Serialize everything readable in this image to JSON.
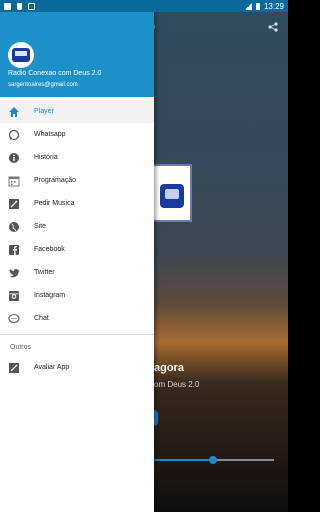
{
  "status_bar": {
    "time": "13:29",
    "icons": [
      "download-icon",
      "music-icon",
      "n-icon"
    ]
  },
  "player": {
    "header_fragment": "0",
    "title_fragment": "agora",
    "subtitle_fragment": "om Deus 2.0",
    "seek_progress": 0.49
  },
  "drawer": {
    "station_name": "Radio Conexao com Deus 2.0",
    "email": "sargentoaires@gmail.com",
    "items": [
      {
        "label": "Player",
        "icon": "home-icon",
        "active": true
      },
      {
        "label": "Whatsapp",
        "icon": "whatsapp-icon",
        "active": false
      },
      {
        "label": "História",
        "icon": "info-icon",
        "active": false
      },
      {
        "label": "Programação",
        "icon": "calendar-icon",
        "active": false
      },
      {
        "label": "Pedir Musica",
        "icon": "request-icon",
        "active": false
      },
      {
        "label": "Site",
        "icon": "globe-icon",
        "active": false
      },
      {
        "label": "Facebook",
        "icon": "facebook-icon",
        "active": false
      },
      {
        "label": "Twitter",
        "icon": "twitter-icon",
        "active": false
      },
      {
        "label": "Instagram",
        "icon": "instagram-icon",
        "active": false
      },
      {
        "label": "Chat",
        "icon": "chat-icon",
        "active": false
      }
    ],
    "section_label": "Outros",
    "extra_items": [
      {
        "label": "Avaliar App",
        "icon": "rate-icon",
        "active": false
      }
    ]
  },
  "colors": {
    "accent": "#1e88c8",
    "header": "#1e90c8",
    "status_bar": "#0a6a9a"
  }
}
